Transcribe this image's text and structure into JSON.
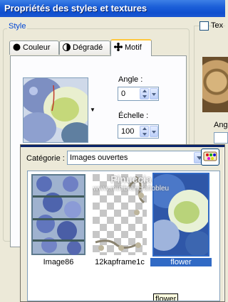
{
  "window": {
    "title": "Propriétés des styles et textures"
  },
  "style_group": {
    "label": "Style"
  },
  "tabs": [
    {
      "label": "Couleur",
      "icon": "solid-color-icon"
    },
    {
      "label": "Dégradé",
      "icon": "gradient-icon"
    },
    {
      "label": "Motif",
      "icon": "pattern-icon",
      "active": true
    }
  ],
  "pattern": {
    "angle_label": "Angle :",
    "angle_value": "0",
    "scale_label": "Échelle :",
    "scale_value": "100"
  },
  "right_partial": {
    "checkbox_label": "Tex",
    "label2": "Ang"
  },
  "popup": {
    "category_label": "Catégorie :",
    "category_value": "Images ouvertes",
    "palette_button_icon": "palette-icon",
    "thumbnails": [
      {
        "label": "Image86",
        "selected": false
      },
      {
        "label": "12kapframe1c",
        "selected": false
      },
      {
        "label": "flower",
        "selected": true
      }
    ],
    "tooltip": "flower",
    "watermark": "Pinuccia",
    "watermark_sub": "www.mutibraricrafiobleu"
  },
  "colors": {
    "titlebar": "#0f4fcf",
    "selection": "#316ac5",
    "group_label": "#0046d5",
    "dialog_bg": "#ece9d8"
  }
}
